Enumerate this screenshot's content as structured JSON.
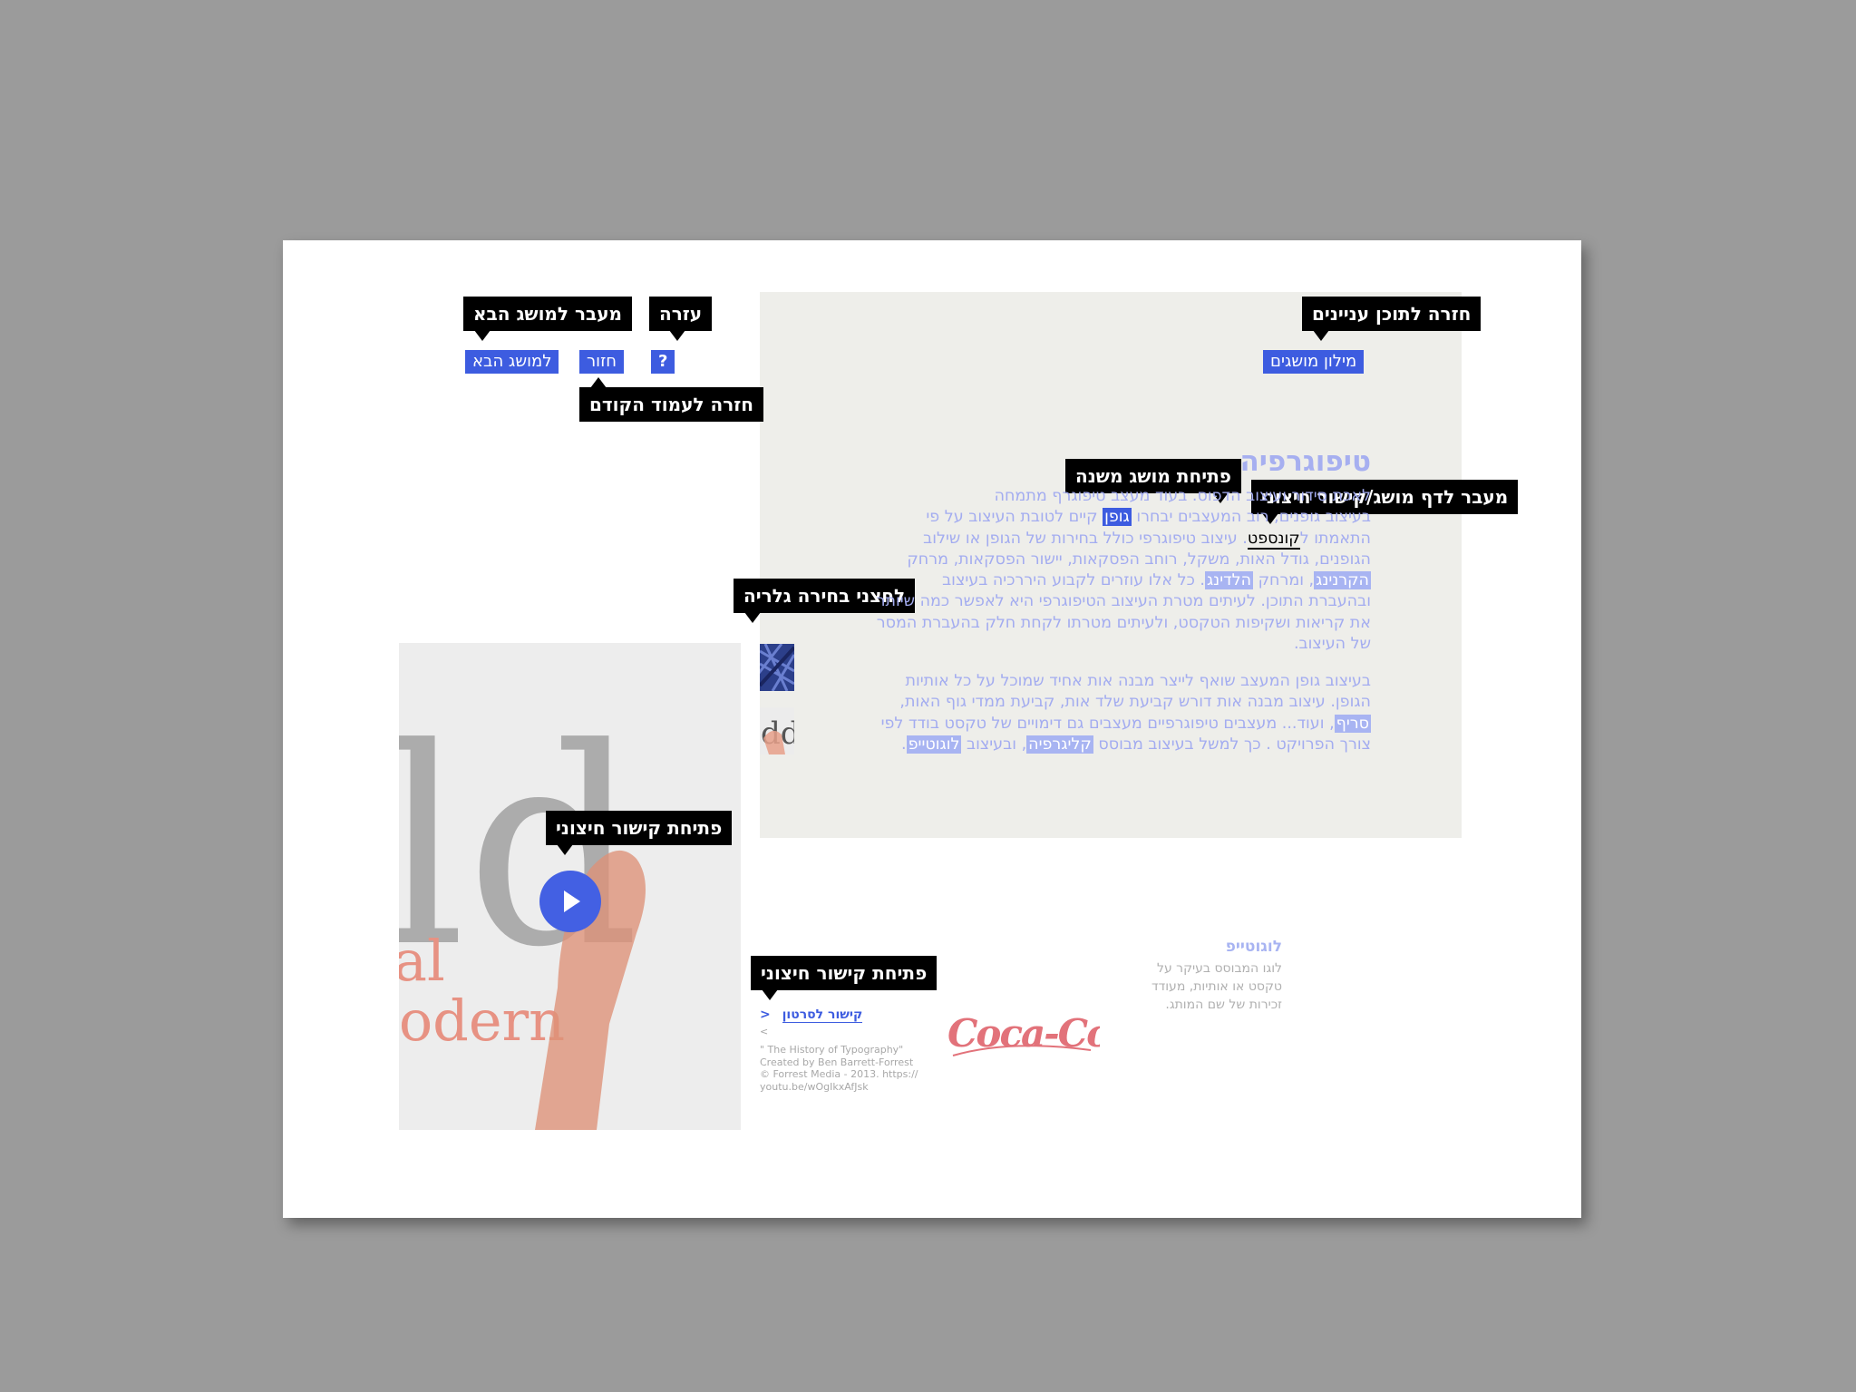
{
  "nav": {
    "glossary_label": "מילון מושגים",
    "next_term_label": "למושג הבא",
    "back_label": "חזור",
    "help_label": "?"
  },
  "tooltips": {
    "back_to_contents": "חזרה לתוכן עניינים",
    "next_term": "מעבר למושג הבא",
    "help": "עזרה",
    "previous_page": "חזרה לעמוד הקודם",
    "open_subterm": "פתיחת מושג משנה",
    "term_page_link": "מעבר לדף מושג/קישור חיצוני",
    "gallery_buttons": "לחצני בחירה גלריה",
    "open_external_video": "פתיחת קישור חיצוני",
    "open_external_link": "פתיחת קישור חיצוני"
  },
  "article": {
    "title": "טיפוגרפיה",
    "p1_l1": "לאכת סידור ועיצוב הדפוס. בעוד מעצב טיפוגרף מתמחה",
    "p1_l2_a": "בעיצוב גופנים, רוב המעצבים יבחרו ",
    "p1_l2_hl": "גופן",
    "p1_l2_b": " קיים לטובת העיצוב על פי",
    "p1_l3_a": "התאמתו ל",
    "p1_l3_kw": "קונספט",
    "p1_l3_b": ". עיצוב טיפוגרפי כולל בחירות של הגופן או שילוב",
    "p1_l4": "הגופנים, גודל האות, משקל, רוחב הפסקאות, יישור הפסקאות, מרחק",
    "p1_l5_hl1": "הקרנינג",
    "p1_l5_a": ", ומרחק ",
    "p1_l5_hl2": "הלדינג",
    "p1_l5_b": ". כל אלו עוזרים לקבוע היררכיה בעיצוב",
    "p1_l6": "ובהעברת התוכן. לעיתים מטרת העיצוב הטיפוגרפי היא לאפשר כמה שיותר",
    "p1_l7": "את קריאות ושקיפות הטקסט, ולעיתים מטרתו לקחת חלק בהעברת המסר",
    "p1_l8": "של העיצוב.",
    "p2_l1": "בעיצוב גופן המעצב שואף לייצר מבנה אות אחיד שמוכל על כל אותיות",
    "p2_l2": "הגופן. עיצוב מבנה אות דורש קביעת שלד אות, קביעת ממדי גוף האות,",
    "p2_l3_hl": "סריף",
    "p2_l3_b": ", ועוד... מעצבים טיפוגרפיים מעצבים גם דימויים של טקסט בודד לפי",
    "p2_l4_a": "צורך הפרויקט . כך למשל בעיצוב מבוסס ",
    "p2_l4_hl1": "קליגרפיה",
    "p2_l4_b": ", ובעיצוב ",
    "p2_l4_hl2": "לוגוטייפ",
    "p2_l4_c": "."
  },
  "logotype": {
    "title": "לוגוטייפ",
    "desc_l1": "לוגו המבוסס בעיקר על",
    "desc_l2": "טקסט או אותיות, מעודד",
    "desc_l3": "זכירות של שם המותג.",
    "brand_text": "Coca-Cola"
  },
  "video": {
    "link_label": "קישור לסרטון",
    "link_arrow": ">",
    "caption_mark": "<",
    "credit_l1": "\" The History of Typography\"",
    "credit_l2": "Created by Ben Barrett-Forrest",
    "credit_l3": "© Forrest Media - 2013. https://",
    "credit_l4": "youtu.be/wOgIkxAfJsk",
    "frame_text_1": "ld",
    "frame_text_2": "al",
    "frame_text_3": "lodern"
  },
  "colors": {
    "accent": "#3d5ce0",
    "accent_light": "#a8b4f2",
    "panel_bg": "#eeeeea",
    "tooltip_bg": "#000000",
    "backdrop": "#9b9b9b"
  }
}
